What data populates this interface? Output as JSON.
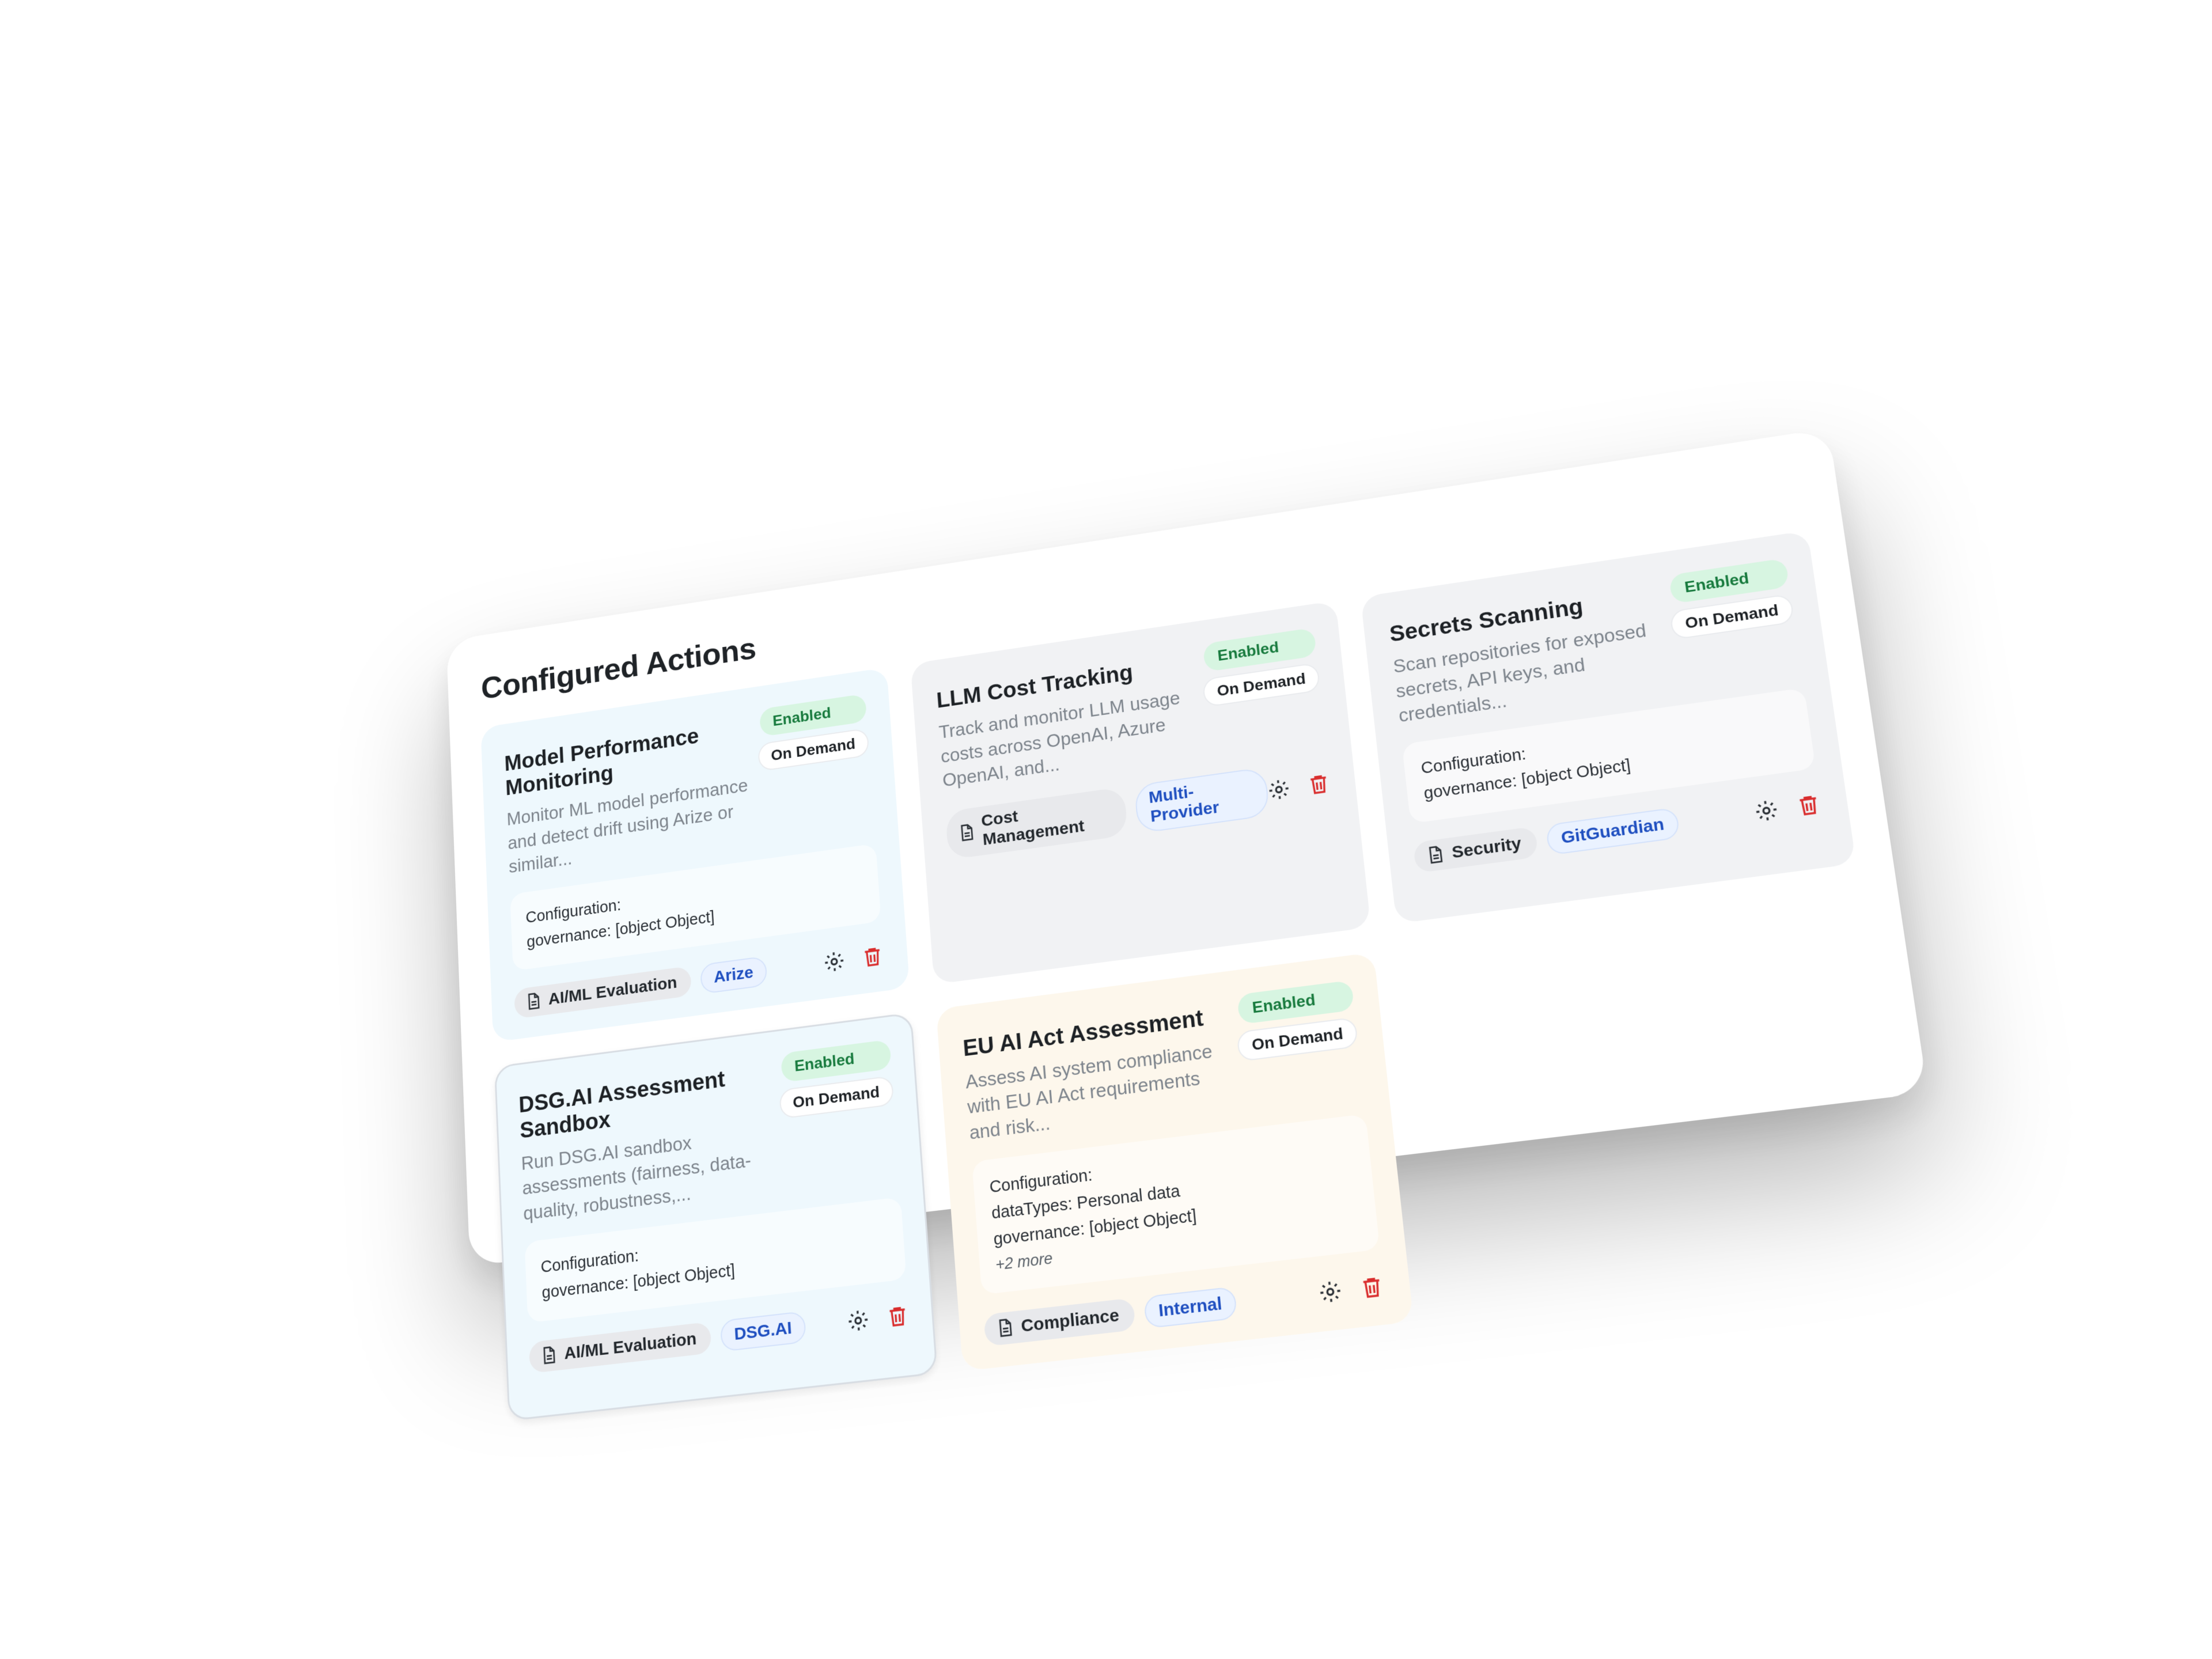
{
  "panel": {
    "title": "Configured Actions"
  },
  "cards": [
    {
      "title": "Model Performance Monitoring",
      "description": "Monitor ML model performance and detect drift using Arize or similar...",
      "status": "Enabled",
      "schedule": "On Demand",
      "config_label": "Configuration:",
      "config_lines": [
        "governance: [object Object]"
      ],
      "more": "",
      "category": "AI/ML Evaluation",
      "provider": "Arize"
    },
    {
      "title": "LLM Cost Tracking",
      "description": "Track and monitor LLM usage costs across OpenAI, Azure OpenAI, and...",
      "status": "Enabled",
      "schedule": "On Demand",
      "config_label": "",
      "config_lines": [],
      "more": "",
      "category": "Cost Management",
      "provider": "Multi-Provider"
    },
    {
      "title": "Secrets Scanning",
      "description": "Scan repositories for exposed secrets, API keys, and credentials...",
      "status": "Enabled",
      "schedule": "On Demand",
      "config_label": "Configuration:",
      "config_lines": [
        "governance: [object Object]"
      ],
      "more": "",
      "category": "Security",
      "provider": "GitGuardian"
    },
    {
      "title": "DSG.AI Assessment Sandbox",
      "description": "Run DSG.AI sandbox assessments (fairness, data-quality, robustness,...",
      "status": "Enabled",
      "schedule": "On Demand",
      "config_label": "Configuration:",
      "config_lines": [
        "governance: [object Object]"
      ],
      "more": "",
      "category": "AI/ML Evaluation",
      "provider": "DSG.AI"
    },
    {
      "title": "EU AI Act Assessment",
      "description": "Assess AI system compliance with EU AI Act requirements and risk...",
      "status": "Enabled",
      "schedule": "On Demand",
      "config_label": "Configuration:",
      "config_lines": [
        "dataTypes: Personal data",
        "governance: [object Object]"
      ],
      "more": "+2 more",
      "category": "Compliance",
      "provider": "Internal"
    }
  ],
  "colors": {
    "enabled_bg": "#d7f5e1",
    "enabled_text": "#177a3d",
    "provider_text": "#1f4fc0",
    "delete_icon": "#d92d2d",
    "card_blue": "#eef8fd",
    "card_gray": "#f1f2f4",
    "card_cream": "#fdf7ec"
  },
  "icons": {
    "category": "document-icon",
    "configure": "gear-icon",
    "delete": "trash-icon"
  }
}
